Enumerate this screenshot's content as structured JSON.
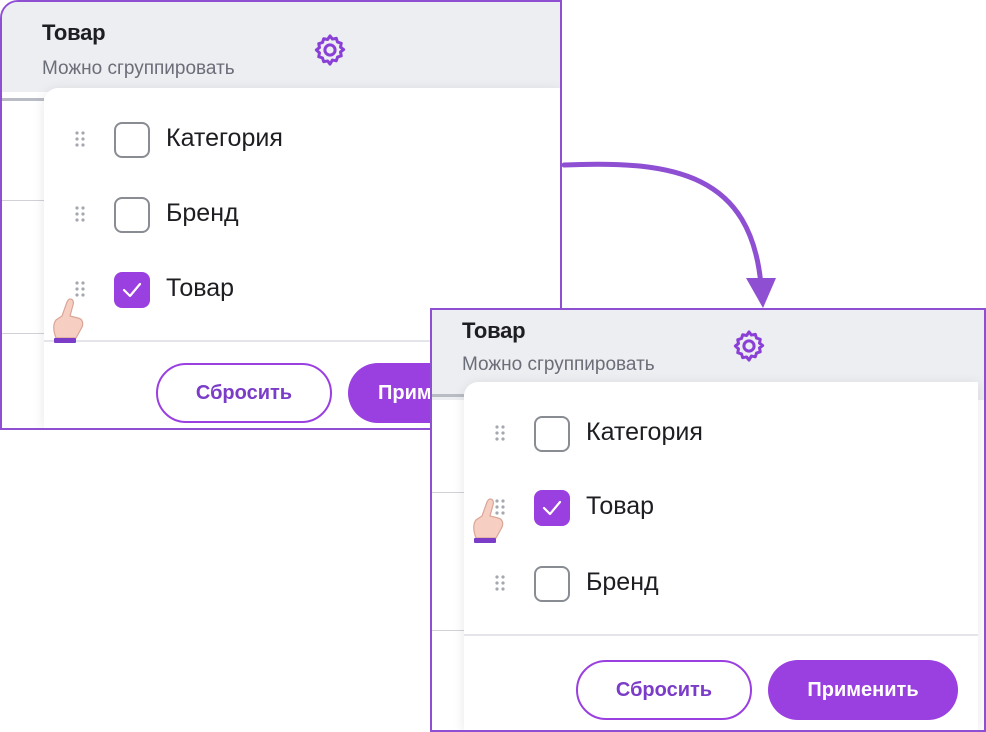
{
  "accent_color": "#9a3fe0",
  "before": {
    "header": {
      "title": "Товар",
      "subtitle": "Можно сгруппировать"
    },
    "items": [
      {
        "label": "Категория",
        "checked": false
      },
      {
        "label": "Бренд",
        "checked": false
      },
      {
        "label": "Товар",
        "checked": true
      }
    ],
    "buttons": {
      "reset": "Сбросить",
      "apply": "Прим"
    }
  },
  "after": {
    "header": {
      "title": "Товар",
      "subtitle": "Можно сгруппировать"
    },
    "items": [
      {
        "label": "Категория",
        "checked": false
      },
      {
        "label": "Товар",
        "checked": true
      },
      {
        "label": "Бренд",
        "checked": false
      }
    ],
    "buttons": {
      "reset": "Сбросить",
      "apply": "Применить"
    }
  },
  "icons": [
    "gear-icon",
    "drag-handle-icon",
    "checkmark-icon",
    "hand-pointer-icon",
    "curved-arrow-icon"
  ]
}
